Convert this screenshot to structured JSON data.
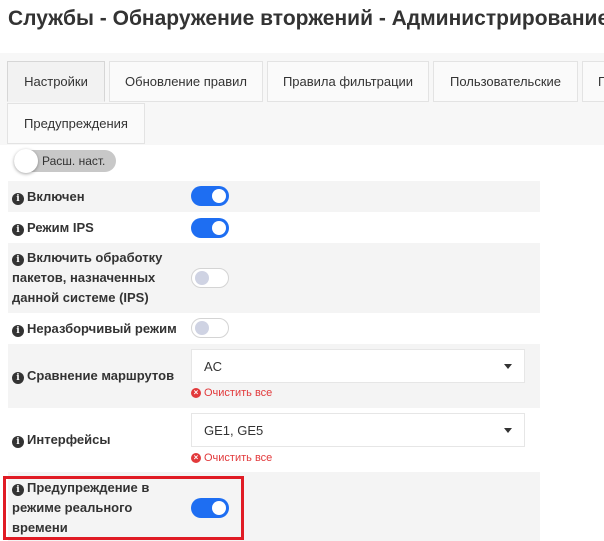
{
  "page": {
    "title": "Службы - Обнаружение вторжений - Администрирование"
  },
  "tabs": [
    {
      "label": "Настройки",
      "active": true
    },
    {
      "label": "Обновление правил"
    },
    {
      "label": "Правила фильтрации"
    },
    {
      "label": "Пользовательские"
    },
    {
      "label": "П"
    },
    {
      "label": "Предупреждения"
    }
  ],
  "advanced_toggle": {
    "label": "Расш. наст.",
    "state": "off"
  },
  "form": {
    "enabled": {
      "label": "Включен",
      "state": "on"
    },
    "ips_mode": {
      "label": "Режим IPS",
      "state": "on"
    },
    "local_packets": {
      "label_lines": [
        "Включить обработку",
        "пакетов, назначенных",
        "данной системе (IPS)"
      ],
      "state": "off"
    },
    "promiscuous": {
      "label": "Неразборчивый режим",
      "state": "off"
    },
    "pattern_matcher": {
      "label": "Сравнение маршрутов",
      "value": "AC",
      "clear_label": "Очистить все"
    },
    "interfaces": {
      "label": "Интерфейсы",
      "value": "GE1, GE5",
      "clear_label": "Очистить все"
    },
    "realtime_alerts": {
      "label_lines": [
        "Предупреждение в",
        "режиме реального",
        "времени"
      ],
      "state": "on"
    }
  },
  "colors": {
    "switch_on": "#1e6ef2",
    "highlight": "#e01b24",
    "clear_text": "#e2393b"
  },
  "icons": {
    "info": "info-circle-icon",
    "clear": "times-circle-icon",
    "dropdown": "caret-down-icon"
  }
}
